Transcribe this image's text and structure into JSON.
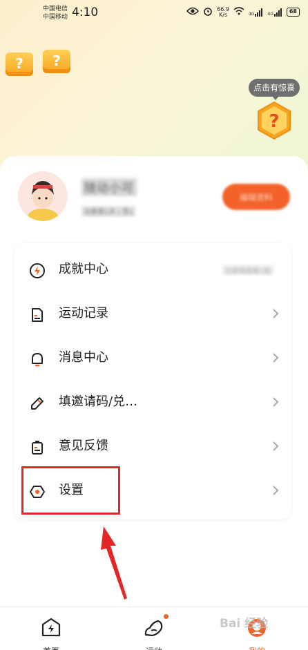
{
  "status_bar": {
    "carrier_1": "中国电信",
    "carrier_2": "中国移动",
    "time": "4:10",
    "net_speed_value": "66.9",
    "net_speed_unit": "K/s",
    "signal_1": "4G",
    "signal_2": "4G",
    "battery": "68"
  },
  "header": {
    "surprise_bubble": "点击有惊喜",
    "mystery_box_glyph": "?"
  },
  "profile": {
    "username": "随动小可",
    "sub_info": "注册第1天 | 签1",
    "action_button": "编辑资料"
  },
  "menu": {
    "items": [
      {
        "label": "成就中心",
        "icon": "lightning-circle-icon",
        "trailing": "已获得勋章1枚"
      },
      {
        "label": "运动记录",
        "icon": "record-doc-icon"
      },
      {
        "label": "消息中心",
        "icon": "bell-icon"
      },
      {
        "label": "填邀请码/兑…",
        "icon": "pencil-icon"
      },
      {
        "label": "意见反馈",
        "icon": "clipboard-icon"
      },
      {
        "label": "设置",
        "icon": "gear-hexagon-icon"
      }
    ]
  },
  "tabs": [
    {
      "label": "首页",
      "icon": "home-lightning-icon"
    },
    {
      "label": "运动",
      "icon": "sneaker-icon"
    },
    {
      "label": "我的",
      "icon": "profile-face-icon"
    }
  ],
  "colors": {
    "accent": "#f2622a",
    "highlight": "#e32626"
  },
  "watermark": "Bai 经验"
}
